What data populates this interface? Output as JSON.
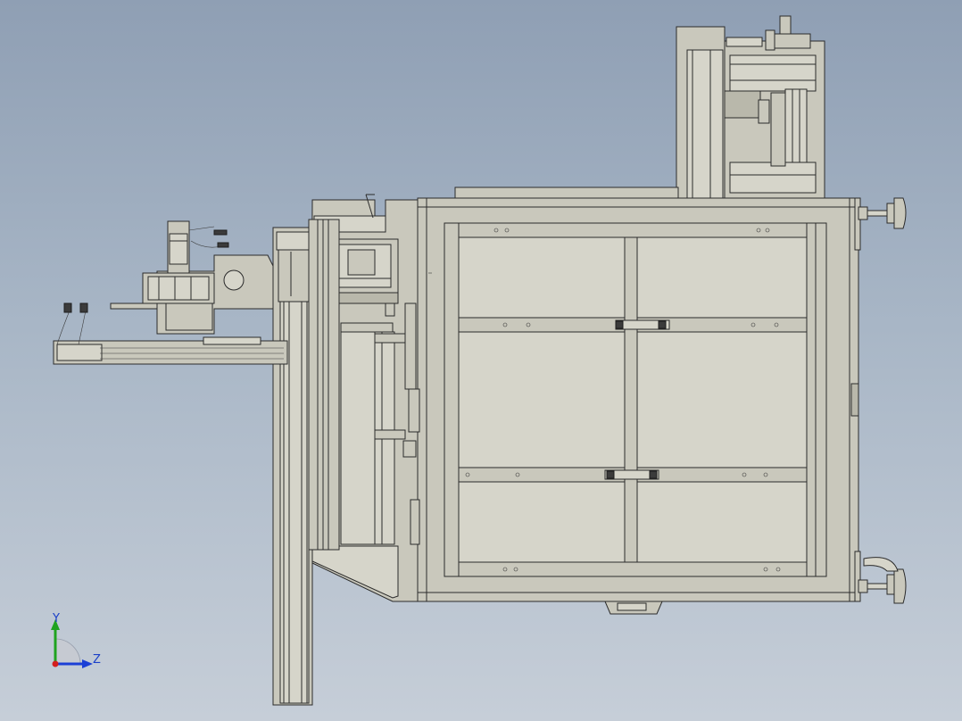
{
  "viewport": {
    "background_top": "#8f9fb4",
    "background_bottom": "#c6ced8",
    "part_color": "#c9c8bc",
    "edge_color": "#2b2b2b"
  },
  "triad": {
    "y_label": "Y",
    "z_label": "Z",
    "y_color": "#1fa31f",
    "z_color": "#1b3fd6",
    "x_color": "#d41e1e"
  }
}
